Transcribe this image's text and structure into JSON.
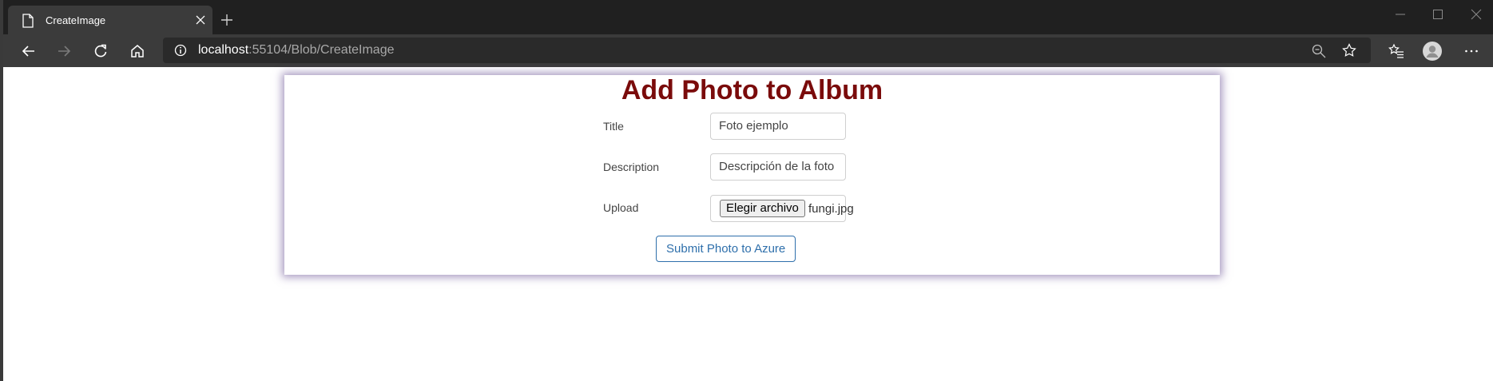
{
  "browser": {
    "tab": {
      "title": "CreateImage"
    },
    "address": {
      "host": "localhost",
      "rest": ":55104/Blob/CreateImage"
    }
  },
  "page": {
    "heading": "Add Photo to Album",
    "form": {
      "title_label": "Title",
      "title_value": "Foto ejemplo",
      "description_label": "Description",
      "description_value": "Descripción de la foto",
      "upload_label": "Upload",
      "file_button": "Elegir archivo",
      "file_name": "fungi.jpg",
      "submit_label": "Submit Photo to Azure"
    }
  },
  "colors": {
    "heading": "#7a0b0b",
    "submit_accent": "#2e6fab",
    "card_shadow": "#5f468c"
  },
  "icons": [
    "page-icon",
    "close-icon",
    "plus-icon",
    "minimize-icon",
    "maximize-icon",
    "window-close-icon",
    "back-arrow-icon",
    "forward-arrow-icon",
    "reload-icon",
    "home-icon",
    "info-icon",
    "zoom-out-icon",
    "star-icon",
    "favorites-icon",
    "profile-icon",
    "more-icon"
  ]
}
